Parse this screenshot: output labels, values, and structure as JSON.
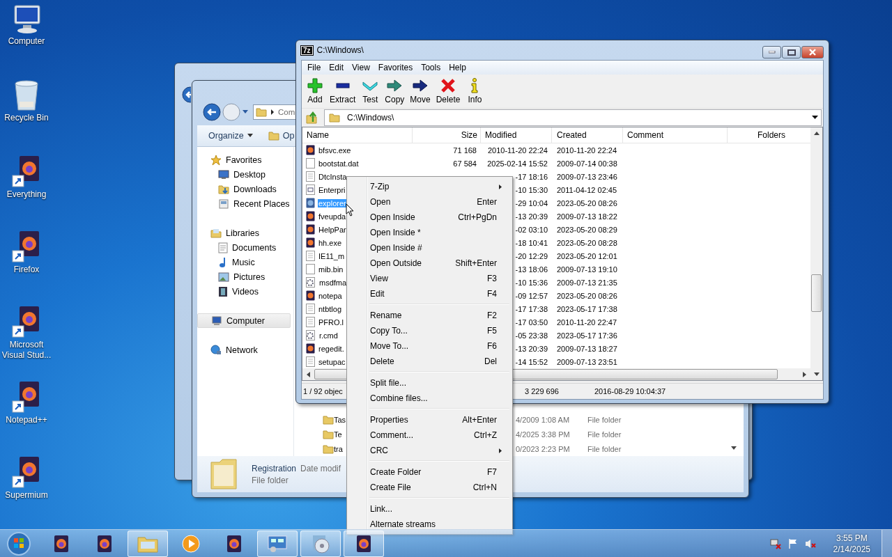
{
  "desktop_icons": [
    {
      "label": "Computer",
      "kind": "computer"
    },
    {
      "label": "Recycle Bin",
      "kind": "bin"
    },
    {
      "label": "Everything",
      "kind": "app"
    },
    {
      "label": "Firefox",
      "kind": "app"
    },
    {
      "label": "Microsoft Visual Stud...",
      "kind": "app"
    },
    {
      "label": "Notepad++",
      "kind": "app"
    },
    {
      "label": "Supermium",
      "kind": "app"
    }
  ],
  "explorer": {
    "address": "Com",
    "toolbar": [
      "Organize",
      "Op"
    ],
    "nav": [
      {
        "label": "Favorites",
        "kind": "star",
        "selected": false,
        "children": [
          {
            "label": "Desktop",
            "kind": "desktop",
            "selected": false
          },
          {
            "label": "Downloads",
            "kind": "download",
            "selected": false
          },
          {
            "label": "Recent Places",
            "kind": "recent",
            "selected": false
          }
        ]
      },
      {
        "label": "Libraries",
        "kind": "library",
        "selected": false,
        "children": [
          {
            "label": "Documents",
            "kind": "doc",
            "selected": false
          },
          {
            "label": "Music",
            "kind": "music",
            "selected": false
          },
          {
            "label": "Pictures",
            "kind": "picture",
            "selected": false
          },
          {
            "label": "Videos",
            "kind": "video",
            "selected": false
          }
        ]
      },
      {
        "label": "Computer",
        "kind": "computer",
        "selected": true
      },
      {
        "label": "Network",
        "kind": "network",
        "selected": false
      }
    ],
    "rows": [
      {
        "name": "Tas",
        "date": "4/2009 1:08 AM",
        "type": "File folder"
      },
      {
        "name": "Te",
        "date": "4/2025 3:38 PM",
        "type": "File folder"
      },
      {
        "name": "tra",
        "date": "0/2023 2:23 PM",
        "type": "File folder"
      }
    ],
    "details": {
      "name": "Registration",
      "date_label": "Date modif",
      "type": "File folder"
    }
  },
  "sevenzip": {
    "logo_text": "7z",
    "title": "C:\\Windows\\",
    "menu": [
      "File",
      "Edit",
      "View",
      "Favorites",
      "Tools",
      "Help"
    ],
    "toolbar": [
      {
        "label": "Add",
        "kind": "plus"
      },
      {
        "label": "Extract",
        "kind": "minus"
      },
      {
        "label": "Test",
        "kind": "check"
      },
      {
        "label": "Copy",
        "kind": "copy"
      },
      {
        "label": "Move",
        "kind": "move"
      },
      {
        "label": "Delete",
        "kind": "cross"
      },
      {
        "label": "Info",
        "kind": "info"
      }
    ],
    "address": "C:\\Windows\\",
    "columns": [
      "Name",
      "Size",
      "Modified",
      "Created",
      "Comment",
      "Folders"
    ],
    "rows": [
      {
        "name": "bfsvc.exe",
        "kind": "app",
        "size": "71 168",
        "modified": "2010-11-20 22:24",
        "created": "2010-11-20 22:24",
        "selected": false
      },
      {
        "name": "bootstat.dat",
        "kind": "blank",
        "size": "67 584",
        "modified": "2025-02-14 15:52",
        "created": "2009-07-14 00:38",
        "selected": false
      },
      {
        "name": "DtcInsta",
        "kind": "text",
        "modified": "-17 18:16",
        "created": "2009-07-13 23:46",
        "selected": false
      },
      {
        "name": "Enterpri",
        "kind": "config",
        "modified": "-10 15:30",
        "created": "2011-04-12 02:45",
        "selected": false
      },
      {
        "name": "explorer",
        "kind": "explorer",
        "modified": "-29 10:04",
        "created": "2023-05-20 08:26",
        "selected": true
      },
      {
        "name": "fveupda",
        "kind": "app",
        "modified": "-13 20:39",
        "created": "2009-07-13 18:22",
        "selected": false
      },
      {
        "name": "HelpPar",
        "kind": "app",
        "modified": "-02 03:10",
        "created": "2023-05-20 08:29",
        "selected": false
      },
      {
        "name": "hh.exe",
        "kind": "app",
        "modified": "-18 10:41",
        "created": "2023-05-20 08:28",
        "selected": false
      },
      {
        "name": "IE11_m",
        "kind": "text",
        "modified": "-20 12:29",
        "created": "2023-05-20 12:01",
        "selected": false
      },
      {
        "name": "mib.bin",
        "kind": "blank",
        "modified": "-13 18:06",
        "created": "2009-07-13 19:10",
        "selected": false
      },
      {
        "name": "msdfma",
        "kind": "gear",
        "modified": "-10 15:36",
        "created": "2009-07-13 21:35",
        "selected": false
      },
      {
        "name": "notepa",
        "kind": "app",
        "modified": "-09 12:57",
        "created": "2023-05-20 08:26",
        "selected": false
      },
      {
        "name": "ntbtlog",
        "kind": "text",
        "modified": "-17 17:38",
        "created": "2023-05-17 17:38",
        "selected": false
      },
      {
        "name": "PFRO.l",
        "kind": "text",
        "modified": "-17 03:50",
        "created": "2010-11-20 22:47",
        "selected": false
      },
      {
        "name": "r.cmd",
        "kind": "gear",
        "modified": "-05 23:38",
        "created": "2023-05-17 17:36",
        "selected": false
      },
      {
        "name": "regedit.",
        "kind": "app",
        "modified": "-13 20:39",
        "created": "2009-07-13 18:27",
        "selected": false
      },
      {
        "name": "setupac",
        "kind": "text",
        "modified": "-14 15:52",
        "created": "2009-07-13 23:51",
        "selected": false
      }
    ],
    "status": [
      "1 / 92 objec",
      "3 229 696",
      "2016-08-29 10:04:37"
    ]
  },
  "context_menu": {
    "groups": [
      [
        {
          "label": "7-Zip",
          "submenu": true
        },
        {
          "label": "Open",
          "shortcut": "Enter",
          "submenu": false
        },
        {
          "label": "Open Inside",
          "shortcut": "Ctrl+PgDn",
          "submenu": false
        },
        {
          "label": "Open Inside *",
          "submenu": false
        },
        {
          "label": "Open Inside #",
          "submenu": false
        },
        {
          "label": "Open Outside",
          "shortcut": "Shift+Enter",
          "submenu": false
        },
        {
          "label": "View",
          "shortcut": "F3",
          "submenu": false
        },
        {
          "label": "Edit",
          "shortcut": "F4",
          "submenu": false
        }
      ],
      [
        {
          "label": "Rename",
          "shortcut": "F2",
          "submenu": false
        },
        {
          "label": "Copy To...",
          "shortcut": "F5",
          "submenu": false
        },
        {
          "label": "Move To...",
          "shortcut": "F6",
          "submenu": false
        },
        {
          "label": "Delete",
          "shortcut": "Del",
          "submenu": false
        }
      ],
      [
        {
          "label": "Split file...",
          "submenu": false
        },
        {
          "label": "Combine files...",
          "submenu": false
        }
      ],
      [
        {
          "label": "Properties",
          "shortcut": "Alt+Enter",
          "submenu": false
        },
        {
          "label": "Comment...",
          "shortcut": "Ctrl+Z",
          "submenu": false
        },
        {
          "label": "CRC",
          "submenu": true
        }
      ],
      [
        {
          "label": "Create Folder",
          "shortcut": "F7",
          "submenu": false
        },
        {
          "label": "Create File",
          "shortcut": "Ctrl+N",
          "submenu": false
        }
      ],
      [
        {
          "label": "Link...",
          "submenu": false
        },
        {
          "label": "Alternate streams",
          "submenu": false
        }
      ]
    ]
  },
  "taskbar": {
    "items": [
      {
        "kind": "app",
        "active": false
      },
      {
        "kind": "app",
        "active": false
      },
      {
        "kind": "folder",
        "active": true
      },
      {
        "kind": "media",
        "active": false
      },
      {
        "kind": "app",
        "active": false
      },
      {
        "kind": "panel",
        "active": true
      },
      {
        "kind": "disc",
        "active": true
      },
      {
        "kind": "app",
        "active": true
      }
    ],
    "time": "3:55 PM",
    "date": "2/14/2025"
  }
}
